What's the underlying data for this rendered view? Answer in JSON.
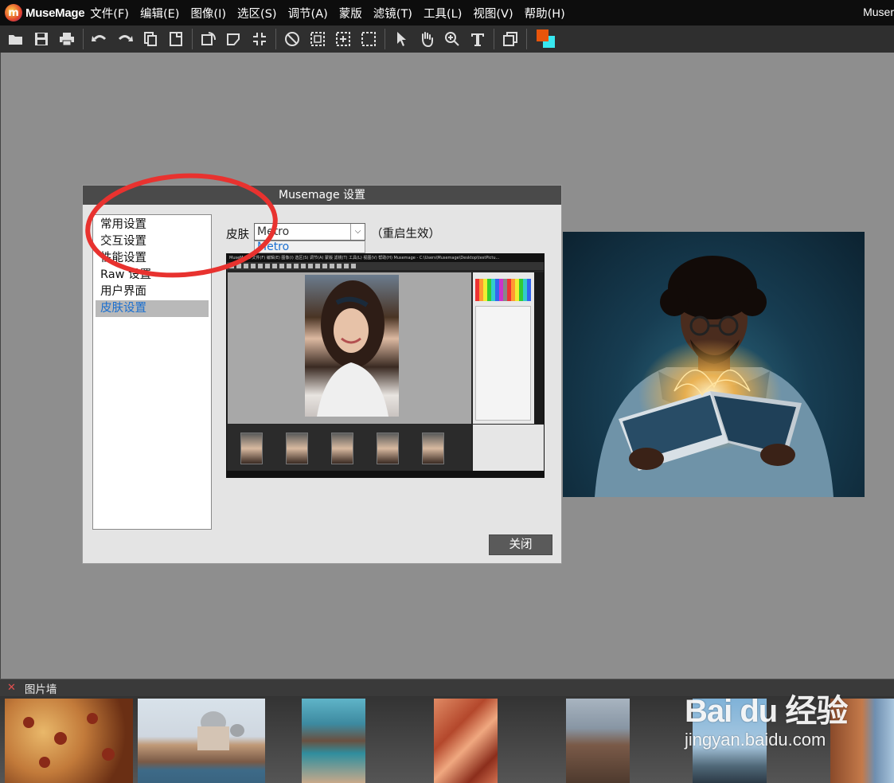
{
  "app": {
    "name": "MuseMage",
    "title_right": "Muser",
    "logo_letter": "m"
  },
  "menu": [
    "文件(F)",
    "编辑(E)",
    "图像(I)",
    "选区(S)",
    "调节(A)",
    "蒙版",
    "滤镜(T)",
    "工具(L)",
    "视图(V)",
    "帮助(H)"
  ],
  "toolbar": {
    "icons": [
      "open-icon",
      "save-icon",
      "print-icon",
      "undo-icon",
      "redo-icon",
      "copy-icon",
      "paste-icon",
      "rotate-icon",
      "crop-icon",
      "fit-icon",
      "deselect-icon",
      "select-all-icon",
      "select-center-icon",
      "select-rect-icon",
      "pointer-icon",
      "hand-icon",
      "zoom-icon",
      "text-icon",
      "layers-icon"
    ],
    "fg_color": "#e8550b",
    "bg_color": "#38e8f0"
  },
  "dialog": {
    "title": "Musemage 设置",
    "settings_items": [
      "常用设置",
      "交互设置",
      "性能设置",
      "Raw 设置",
      "用户界面",
      "皮肤设置"
    ],
    "active_index": 5,
    "skin_label": "皮肤",
    "skin_value": "Metro",
    "skin_option": "Metro",
    "restart_note": "（重启生效）",
    "close_label": "关闭",
    "highlight_color": "#e8322f"
  },
  "preview": {
    "menu_text": "MuseMage  文件(F) 编辑(E) 图像(I) 选区(S) 调节(A) 蒙版 滤镜(T) 工具(L) 视图(V) 帮助(H)        Musemage - C:\\Users\\Musemage\\Desktop\\testPictu..."
  },
  "photowall": {
    "title": "图片墙"
  },
  "watermark": {
    "brand": "Bai du 经验",
    "url": "jingyan.baidu.com"
  }
}
